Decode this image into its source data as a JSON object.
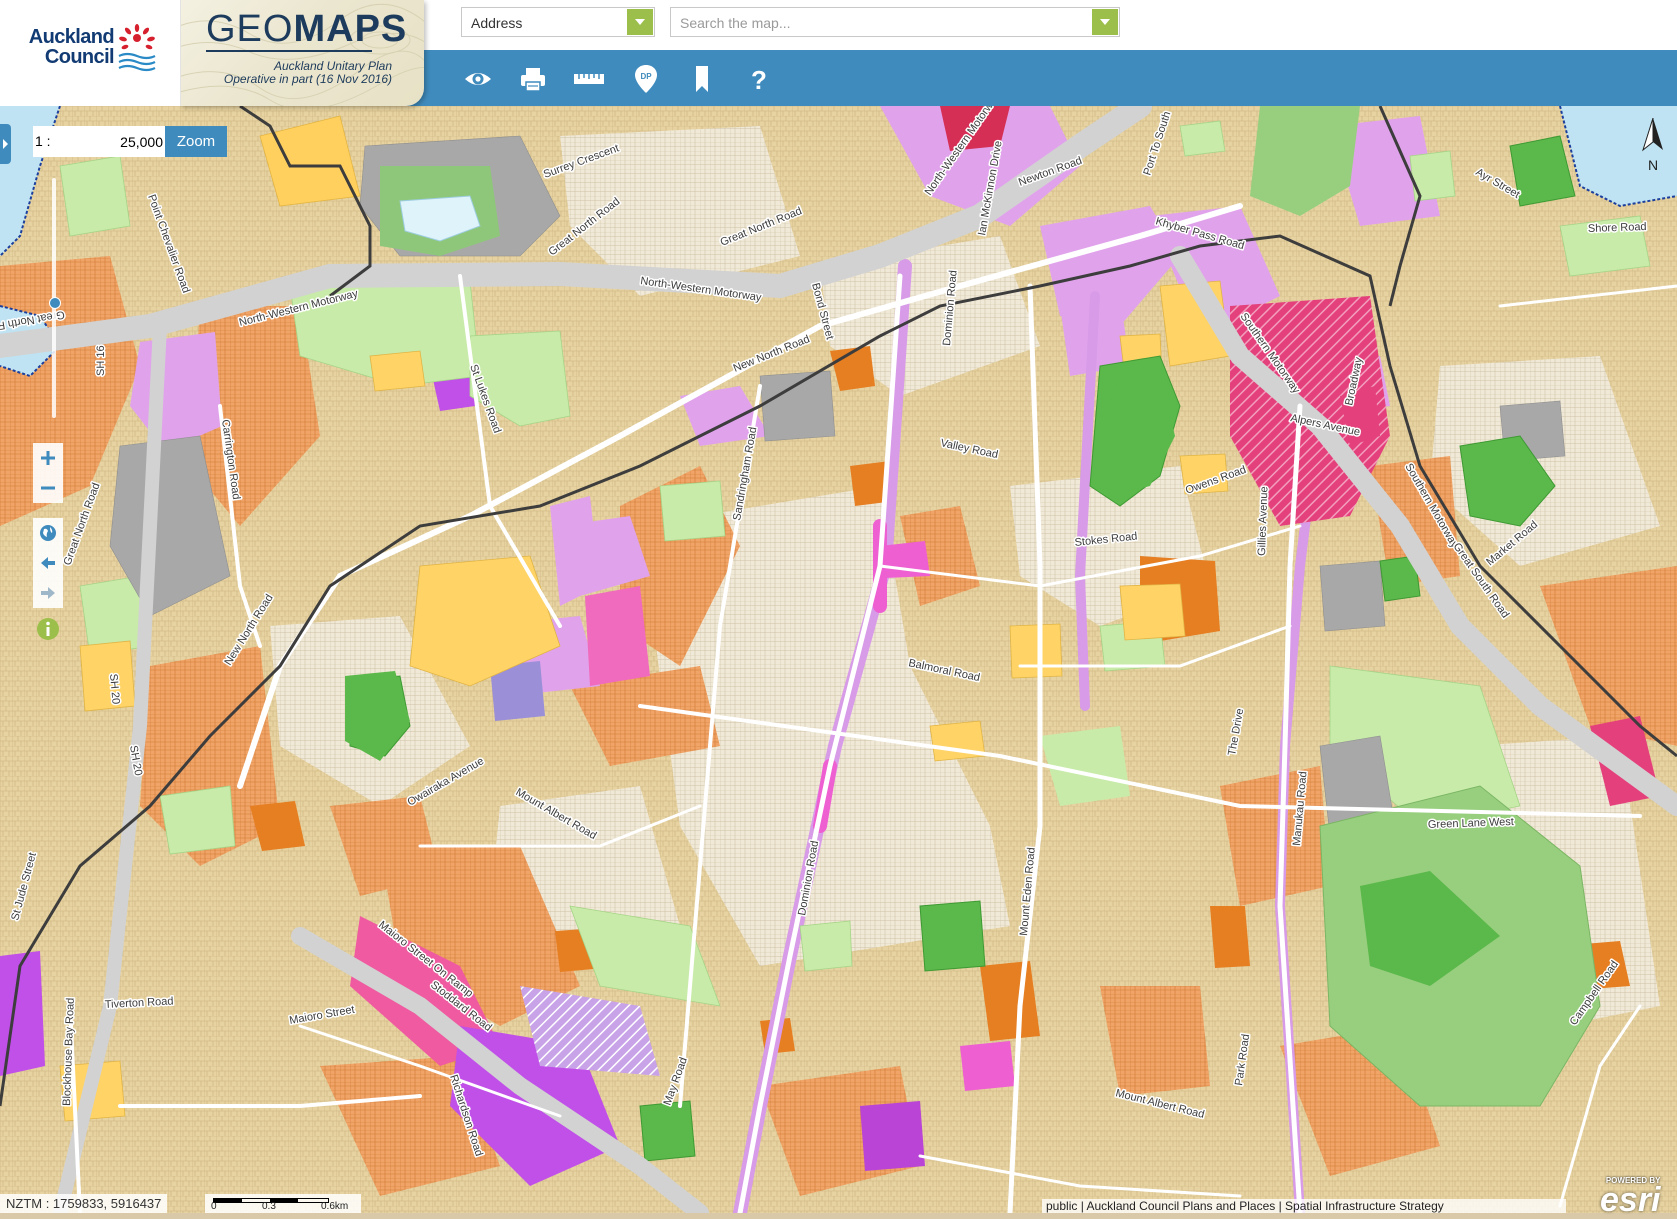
{
  "app": {
    "council_line1": "Auckland",
    "council_line2": "Council",
    "brand_title_light": "GEO",
    "brand_title_bold": "MAPS",
    "brand_subtitle1": "Auckland Unitary Plan",
    "brand_subtitle2": "Operative in part (16 Nov 2016)"
  },
  "search": {
    "type_value": "Address",
    "placeholder": "Search the map..."
  },
  "toolbar": {
    "icons": [
      "eye-icon",
      "print-icon",
      "ruler-icon",
      "dp-marker-icon",
      "bookmark-icon",
      "help-icon"
    ],
    "dp_label": "DP",
    "help_glyph": "?"
  },
  "map_controls": {
    "scale_prefix": "1 :",
    "scale_value": "25,000",
    "zoom_button": "Zoom",
    "zoom_in": "+",
    "zoom_out": "−",
    "north_label": "N"
  },
  "status": {
    "coordinates": "NZTM : 1759833, 5916437",
    "scale_ticks": [
      "0",
      "0.3",
      "0.6km"
    ],
    "attribution": "public | Auckland Council Plans and Places | Spatial Infrastructure Strategy",
    "esri_powered": "POWERED BY",
    "esri": "esri"
  },
  "colors": {
    "header_blue": "#3f8bbd",
    "dropdown_green": "#9bbf4a",
    "logo_navy": "#123b74",
    "residential_mixed": "#e7d3a1",
    "residential_single": "#f0ebdc",
    "residential_terrace": "#e58a3a",
    "town_centre": "#e0a3eb",
    "business_metro": "#e4417c",
    "open_space": "#c8eba9",
    "sport": "#5bb84a",
    "water": "#bfe3f2",
    "motorway": "#cfcfcf"
  },
  "road_labels": [
    "North-Western Motorway",
    "New North Road",
    "Dominion Road",
    "Sandringham Road",
    "Balmoral Road",
    "Valley Road",
    "Mount Eden Road",
    "Manukau Road",
    "Southern Motorway",
    "Green Lane West",
    "Mount Albert Road",
    "Stoddard Road",
    "Maioro Street",
    "Blockhouse Bay Road",
    "Carrington Road",
    "St Lukes Road",
    "Great North Road",
    "Owairaka Avenue",
    "Khyber Pass Road",
    "Broadway",
    "Campbell Road",
    "Shore Road",
    "Richardson Road",
    "Tiverton Road",
    "May Road",
    "Stokes Road",
    "Owens Road",
    "Gillies Avenue",
    "The Drive",
    "Market Road",
    "Great South Road",
    "Alpers Avenue",
    "Newton Road",
    "Surrey Crescent",
    "Point Chevalier Road",
    "Bond Street",
    "Maioro Street On Ramp",
    "Great North Road On Ramp",
    "Port To South",
    "Ian McKinnon Drive",
    "Park Road",
    "Ayr Street",
    "St Jude Street",
    "SH 20",
    "SH 16"
  ]
}
